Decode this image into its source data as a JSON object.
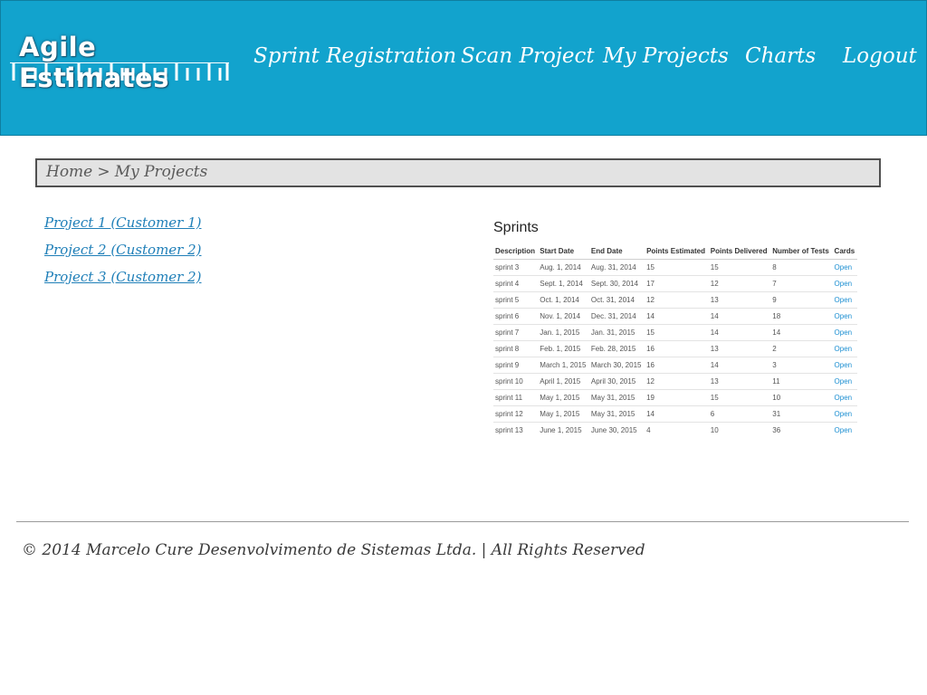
{
  "header": {
    "logo_text": "Agile Estimates",
    "nav": [
      "Sprint Registration",
      "Scan Project",
      "My Projects",
      "Charts",
      "Logout"
    ],
    "bg_color": "#12a3cd"
  },
  "breadcrumb": {
    "home": "Home",
    "separator": ">",
    "current": "My Projects"
  },
  "projects": [
    "Project 1 (Customer 1)",
    "Project 2 (Customer 2)",
    "Project 3 (Customer 2)"
  ],
  "sprints": {
    "title": "Sprints",
    "columns": [
      "Description",
      "Start Date",
      "End Date",
      "Points Estimated",
      "Points Delivered",
      "Number of Tests",
      "Cards"
    ],
    "rows": [
      [
        "sprint 3",
        "Aug. 1, 2014",
        "Aug. 31, 2014",
        "15",
        "15",
        "8",
        "Open"
      ],
      [
        "sprint 4",
        "Sept. 1, 2014",
        "Sept. 30, 2014",
        "17",
        "12",
        "7",
        "Open"
      ],
      [
        "sprint 5",
        "Oct. 1, 2014",
        "Oct. 31, 2014",
        "12",
        "13",
        "9",
        "Open"
      ],
      [
        "sprint 6",
        "Nov. 1, 2014",
        "Dec. 31, 2014",
        "14",
        "14",
        "18",
        "Open"
      ],
      [
        "sprint 7",
        "Jan. 1, 2015",
        "Jan. 31, 2015",
        "15",
        "14",
        "14",
        "Open"
      ],
      [
        "sprint 8",
        "Feb. 1, 2015",
        "Feb. 28, 2015",
        "16",
        "13",
        "2",
        "Open"
      ],
      [
        "sprint 9",
        "March 1, 2015",
        "March 30, 2015",
        "16",
        "14",
        "3",
        "Open"
      ],
      [
        "sprint 10",
        "April 1, 2015",
        "April 30, 2015",
        "12",
        "13",
        "11",
        "Open"
      ],
      [
        "sprint 11",
        "May 1, 2015",
        "May 31, 2015",
        "19",
        "15",
        "10",
        "Open"
      ],
      [
        "sprint 12",
        "May 1, 2015",
        "May 31, 2015",
        "14",
        "6",
        "31",
        "Open"
      ],
      [
        "sprint 13",
        "June 1, 2015",
        "June 30, 2015",
        "4",
        "10",
        "36",
        "Open"
      ]
    ]
  },
  "footer": {
    "text": "© 2014 Marcelo Cure Desenvolvimento de Sistemas Ltda. | All Rights Reserved"
  }
}
